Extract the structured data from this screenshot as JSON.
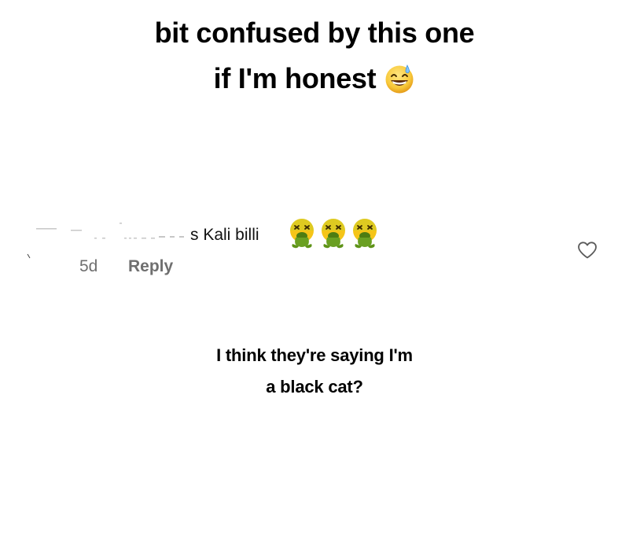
{
  "story": {
    "headline_line1": "bit confused by this one",
    "headline_line2": "if I'm honest",
    "headline_emoji": "grinning-face-with-sweat-emoji"
  },
  "comment": {
    "text": "s Kali billi",
    "emoji": "face-vomiting-emoji",
    "emoji_count": 3,
    "timestamp": "5d",
    "reply_label": "Reply",
    "like_icon": "heart-outline-icon"
  },
  "caption": {
    "line1": "I think they're saying I'm",
    "line2": "a black cat?"
  },
  "colors": {
    "background": "#ffffff",
    "text": "#000000",
    "meta_text": "#6f6f6f",
    "emoji_green": "#6aa022",
    "emoji_yellow": "#f5c518"
  }
}
